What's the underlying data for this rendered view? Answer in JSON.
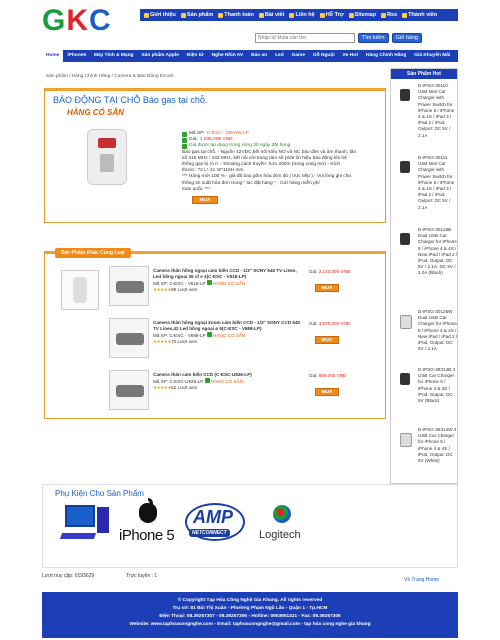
{
  "logo": {
    "g": "G",
    "k": "K",
    "c": "C"
  },
  "topnav": [
    {
      "label": "Giới thiệu"
    },
    {
      "label": "Sản phẩm"
    },
    {
      "label": "Thanh toán"
    },
    {
      "label": "Bài viết"
    },
    {
      "label": "Liên hệ"
    },
    {
      "label": "Hỗ Trợ"
    },
    {
      "label": "Sitemap"
    },
    {
      "label": "Rss"
    },
    {
      "label": "Thành viên"
    }
  ],
  "search": {
    "placeholder": "Nhập từ khóa cần tìm",
    "button": "Tìm kiếm",
    "cart": "Giỏ hàng"
  },
  "mainmenu": [
    "Home",
    "iPhone5",
    "Máy Tính & Mạng",
    "Sản phẩm Apple",
    "Điện tử",
    "Nghe Nhìn AV",
    "Báo an",
    "Led",
    "Game",
    "Gỗ Nguội",
    "Xe Hơi",
    "Hàng Chính Hãng",
    "Giá Khuyến Mãi"
  ],
  "breadcrumb": "Sản phẩm / Hàng Chính Hãng / Camera & Báo Động Excort",
  "product": {
    "title": "BÁO ĐỘNG TẠI CHỖ Báo gas tại chỗ.",
    "stock": "HÀNG CÓ SẴN",
    "code_label": "Mã SP:",
    "code": "C-ESC - 200AW-LP",
    "price_label": "Giá:",
    "price": "1.045.000 VNĐ",
    "promo": "Giá được áp dụng trong vòng 30 ngày đặt hàng",
    "desc_lines": [
      "Báo gas tại chỗ. - Nguồn 12VDC,kết nối kiểu NO và NC báo đèn và âm thanh, tần",
      "số 315 MHz / 433 MHz, kết nối với trung tâm sẽ phát tín hiệu báo động khi hệ",
      "thống gas bị rò rỉ. - Khoảng cách truyền: hơn 200m (trong vùng mở) - Kích",
      "thước: 72 L* 41 W*115H mm",
      "*** Hàng mới 100 % - giá đã bao gồm hóa đơn đỏ ( trực tiếp ) - Vui lòng ghi chú",
      "thông tin xuất hóa đơn trong \" lúc đặt hàng \" - Gửi hàng miễn phí",
      "toàn quốc ***"
    ],
    "buy": "MUA"
  },
  "related": {
    "tab": "Sản Phẩm Khác Cùng Loại",
    "items": [
      {
        "title": "Camera thân hồng ngoại cảm biến CCD - 1/3\" SONY 540 TV Lines, Led hồng ngoại 36 cf e 4(C-ESC - V518-LP)",
        "code": "Mã SP: C-ESC - V518-LP",
        "price": "2.143.000 VNĐ",
        "stock": "HÀNG CÓ SẴN",
        "views": "69 Lượt xem",
        "buy": "MUA"
      },
      {
        "title": "Camera thân hồng ngoại Zoom cảm biến CCD - 1/3\" SONY CCD 540 TV Lines,42 Led hồng ngoại ø 5(C-ESC - V688-LP)",
        "code": "Mã SP: C-ESC - V688-LP",
        "price": "3.879.000 VNĐ",
        "stock": "HÀNG CÓ SẴN",
        "views": "70 Lượt xem",
        "buy": "MUA"
      },
      {
        "title": "Camera thân cảm biến CCD (C-ESC-U926-LP)",
        "code": "Mã SP: C-ESC-U926-LP",
        "price": "865.000 VNĐ",
        "stock": "HÀNG CÓ SẴN",
        "views": "52 Lượt xem",
        "buy": "MUA"
      }
    ],
    "price_label": "Giá:"
  },
  "sidebar": {
    "title": "Sản Phẩm Hot",
    "items": [
      {
        "text": "D-IPSG-30110 USB Mini Car Charger with Power Switch for iPhone 5 / iPhone 4 & 4S / iPad 3 / iPad 2 / iPod, Output: DC 5V / 2.1A"
      },
      {
        "text": "D-IPSG-30111 USB Mini Car Charger with Power Switch for iPhone 5 / iPhone 4 & 4S / iPad 3 / iPad 2 / iPod, Output: DC 5V / 2.1A"
      },
      {
        "text": "D-IPSG-30126B Dual USB Car Charger for iPhone 5 / iPhone 4 & 4S / New iPad / iPad 2 / iPod, Output: DC 5V / 2.1A, DC 5V / 1.0A (Black)"
      },
      {
        "text": "D-IPSG-30126W Dual USB Car Charger for iPhone 5 / iPhone 4 & 4S / New iPad / iPad 2 / iPod, Output: DC 5V / 2.1A"
      },
      {
        "text": "D-IPSG-38314B 4 USB Car Charger for iPhone 5 / iPhone 4 & 4S / iPod, Output: DC 5V (Black)"
      },
      {
        "text": "D-IPSG-38314W 4 USB Car Charger for iPhone 5 / iPhone 4 & 4S / iPod, Output: DC 5V (White)"
      }
    ]
  },
  "accessories": {
    "title": "Phụ Kiện Cho Sản Phẩm",
    "iphone": "iPhone 5",
    "amp": "AMP",
    "amp_sub": "NETCONNECT",
    "logitech": "Logitech"
  },
  "stats": {
    "visits": "Lượt truy cập: 0193629",
    "online": "Trực tuyến : 1",
    "to_top": "Về Trang Home"
  },
  "footer": [
    "© Copyright Tạp Hóa Công Nghệ Gia Khang. All rights reserved",
    "Trụ sở: 81 Bùi Thị Xuân - Phường Phạm Ngũ Lão - Quận 1 - Tp.HCM",
    "Điện Thoại: 08.39257307 - 08.39257306 - Hotline: 0903951321 - Fax: 08.39257306",
    "Website: www.taphoacongnghe.com - Email: taphoacongnghe@gmail.com - tạp hóa cong nghe gia khang"
  ]
}
